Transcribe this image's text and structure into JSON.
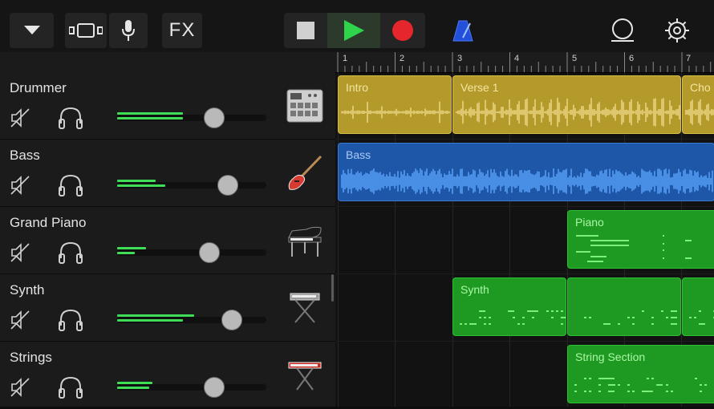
{
  "toolbar": {
    "fx_label": "FX",
    "icons": [
      "chevron-down-icon",
      "view-toggle-icon",
      "microphone-icon",
      "stop-icon",
      "play-icon",
      "record-icon",
      "metronome-icon",
      "loop-browser-icon",
      "settings-gear-icon"
    ],
    "colors": {
      "play": "#2fd44a",
      "record": "#e5262c",
      "metronome": "#3b6cff"
    }
  },
  "ruler": {
    "bars": [
      "1",
      "2",
      "3",
      "4",
      "5",
      "6",
      "7"
    ]
  },
  "tracks": [
    {
      "name": "Drummer",
      "instrument_icon": "drum-machine-icon",
      "volume": 0.65
    },
    {
      "name": "Bass",
      "instrument_icon": "bass-guitar-icon",
      "volume": 0.74
    },
    {
      "name": "Grand Piano",
      "instrument_icon": "grand-piano-icon",
      "volume": 0.62
    },
    {
      "name": "Synth",
      "instrument_icon": "synth-keyboard-icon",
      "volume": 0.77
    },
    {
      "name": "Strings",
      "instrument_icon": "keyboard-stand-icon",
      "volume": 0.65
    }
  ],
  "regions": {
    "intro": "Intro",
    "verse1": "Verse 1",
    "chorus": "Cho",
    "bass": "Bass",
    "piano": "Piano",
    "synth": "Synth",
    "strings": "String Section"
  },
  "region_colors": {
    "drummer": "#b49a2a",
    "bass": "#1f57a8",
    "midi": "#1e9a22"
  }
}
